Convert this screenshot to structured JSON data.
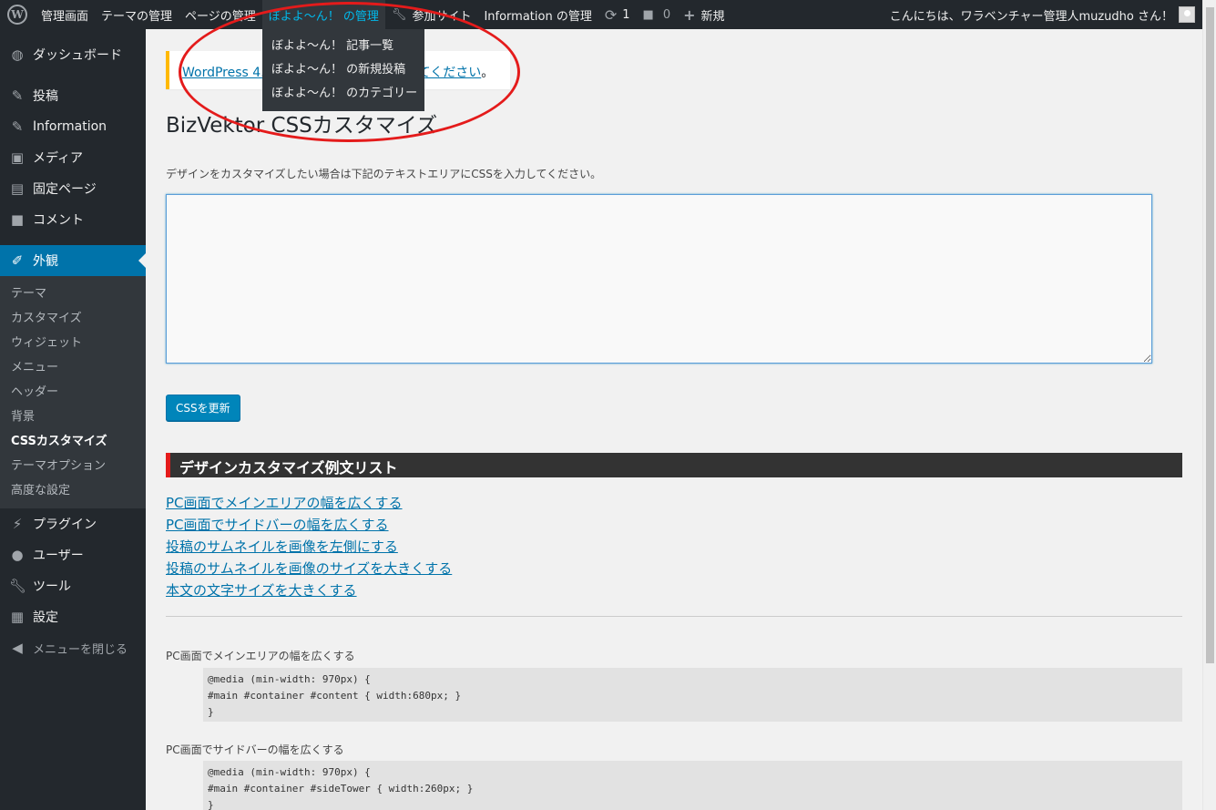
{
  "adminbar": {
    "items": [
      {
        "label": "管理画面"
      },
      {
        "label": "テーマの管理"
      },
      {
        "label": "ページの管理"
      },
      {
        "label": "ぼよよ〜ん！ の管理"
      },
      {
        "label": "参加サイト"
      },
      {
        "label": "Information の管理"
      }
    ],
    "updates_count": "1",
    "comments_count": "0",
    "new_label": "新規",
    "greeting": "こんにちは、ワラベンチャー管理人muzudho さん！"
  },
  "dropdown": {
    "items": [
      "ぼよよ〜ん！ 記事一覧",
      "ぼよよ〜ん！ の新規投稿",
      "ぼよよ〜ん！ のカテゴリー"
    ]
  },
  "sidebar": {
    "items": [
      {
        "label": "ダッシュボード"
      },
      {
        "label": "投稿"
      },
      {
        "label": "Information"
      },
      {
        "label": "メディア"
      },
      {
        "label": "固定ページ"
      },
      {
        "label": "コメント"
      },
      {
        "label": "外観"
      }
    ],
    "submenu": [
      "テーマ",
      "カスタマイズ",
      "ウィジェット",
      "メニュー",
      "ヘッダー",
      "背景",
      "CSSカスタマイズ",
      "テーマオプション",
      "高度な設定"
    ],
    "bottom_items": [
      {
        "label": "プラグイン"
      },
      {
        "label": "ユーザー"
      },
      {
        "label": "ツール"
      },
      {
        "label": "設定"
      }
    ],
    "collapse_label": "メニューを閉じる"
  },
  "main": {
    "notice_link_start": "WordPress 4.",
    "notice_link_end": "てください",
    "notice_suffix": "。",
    "title": "BizVektor CSSカスタマイズ",
    "description": "デザインをカスタマイズしたい場合は下記のテキストエリアにCSSを入力してください。",
    "textarea_value": "",
    "update_button": "CSSを更新",
    "section_title": "デザインカスタマイズ例文リスト",
    "example_links": [
      "PC画面でメインエリアの幅を広くする",
      "PC画面でサイドバーの幅を広くする",
      "投稿のサムネイルを画像を左側にする",
      "投稿のサムネイルを画像のサイズを大きくする",
      "本文の文字サイズを大きくする"
    ],
    "examples": [
      {
        "label": "PC画面でメインエリアの幅を広くする",
        "code": "@media (min-width: 970px) {\n#main #container #content { width:680px; }\n}"
      },
      {
        "label": "PC画面でサイドバーの幅を広くする",
        "code": "@media (min-width: 970px) {\n#main #container #sideTower { width:260px; }\n}"
      }
    ]
  },
  "colors": {
    "adminbar_bg": "#23282d",
    "sidebar_current": "#0073aa",
    "link": "#0073aa",
    "button": "#0085ba",
    "section_accent": "#e41b1b",
    "annotation": "#e41b1b"
  }
}
